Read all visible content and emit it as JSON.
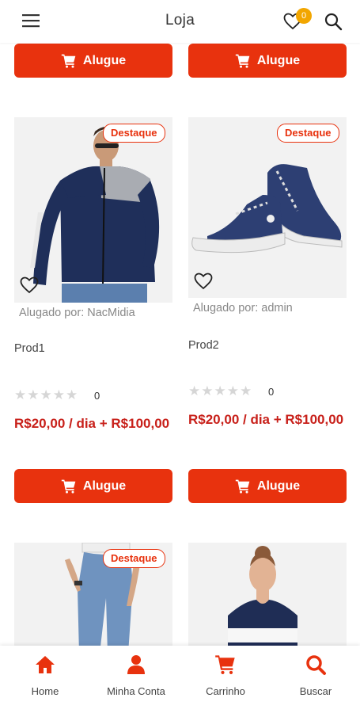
{
  "header": {
    "title": "Loja",
    "favorites_count": "0"
  },
  "products": [
    {
      "tag": "",
      "rented_by": "",
      "name": "",
      "rating_count": "",
      "price": "",
      "rent_label": "Alugue"
    },
    {
      "tag": "",
      "rented_by": "",
      "name": "",
      "rating_count": "",
      "price": "",
      "rent_label": "Alugue"
    },
    {
      "tag": "Destaque",
      "rented_by": "Alugado por: NacMidia",
      "name": "Prod1",
      "rating_count": "0",
      "price": "R$20,00 / dia + R$100,00",
      "rent_label": "Alugue"
    },
    {
      "tag": "Destaque",
      "rented_by": "Alugado por: admin",
      "name": "Prod2",
      "rating_count": "0",
      "price": "R$20,00 / dia + R$100,00",
      "rent_label": "Alugue"
    },
    {
      "tag": "Destaque"
    },
    {
      "tag": ""
    }
  ],
  "bottom_nav": [
    {
      "label": "Home",
      "icon": "home-icon"
    },
    {
      "label": "Minha Conta",
      "icon": "user-icon"
    },
    {
      "label": "Carrinho",
      "icon": "cart-icon"
    },
    {
      "label": "Buscar",
      "icon": "search-icon"
    }
  ],
  "colors": {
    "accent": "#e8320e",
    "price": "#c8201a",
    "badge": "#f2a600"
  }
}
